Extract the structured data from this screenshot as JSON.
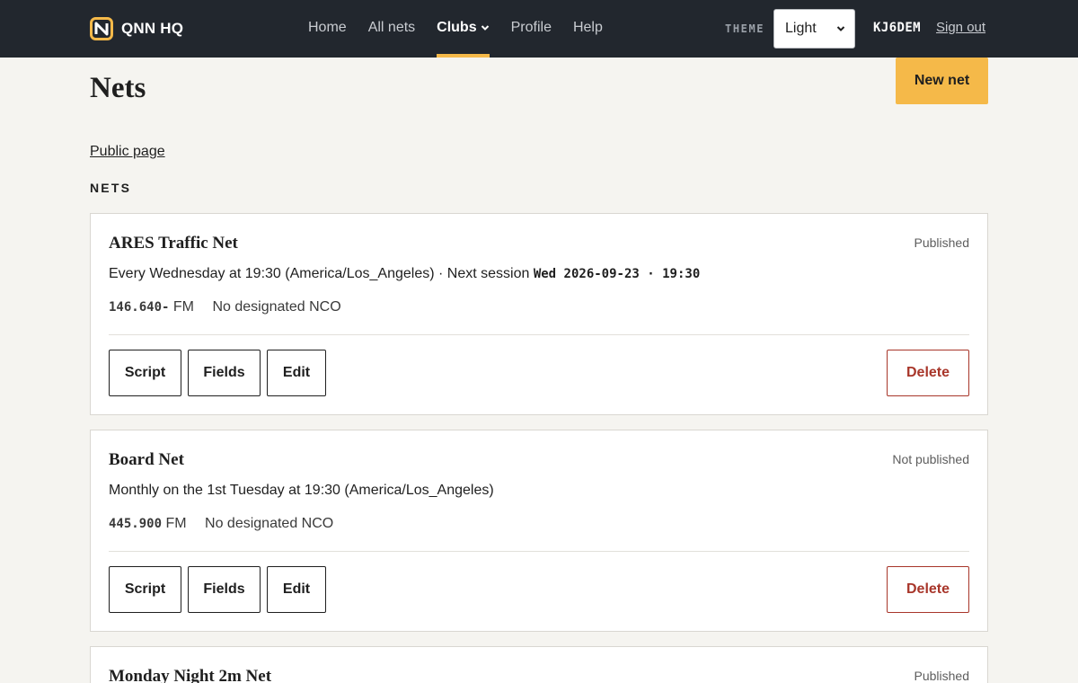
{
  "app": {
    "brand_name": "QNN HQ",
    "accent_color": "#f5b949",
    "nav_bg_color": "#22272e",
    "danger_color": "#a8362a"
  },
  "nav": {
    "items": [
      {
        "label": "Home",
        "active": false
      },
      {
        "label": "All nets",
        "active": false
      },
      {
        "label": "Clubs",
        "active": true,
        "has_dropdown": true
      },
      {
        "label": "Profile",
        "active": false
      },
      {
        "label": "Help",
        "active": false
      }
    ]
  },
  "header": {
    "theme_label": "THEME",
    "theme_value": "Light",
    "callsign": "KJ6DEM",
    "signout_label": "Sign out"
  },
  "page": {
    "title": "Nets",
    "new_net_label": "New net",
    "public_link_label": "Public page",
    "section_label": "NETS"
  },
  "cards": [
    {
      "title": "ARES Traffic Net",
      "status": "Published",
      "schedule": "Every Wednesday at 19:30 (America/Los_Angeles) · Next session",
      "next_session": "Wed 2026-09-23 · 19:30",
      "frequency": "146.640-",
      "mode": "FM",
      "nco": "No designated NCO",
      "buttons": {
        "script": "Script",
        "fields": "Fields",
        "edit": "Edit",
        "delete": "Delete"
      }
    },
    {
      "title": "Board Net",
      "status": "Not published",
      "schedule": "Monthly on the 1st Tuesday at 19:30 (America/Los_Angeles)",
      "frequency": "445.900",
      "mode": "FM",
      "nco": "No designated NCO",
      "buttons": {
        "script": "Script",
        "fields": "Fields",
        "edit": "Edit",
        "delete": "Delete"
      }
    },
    {
      "title": "Monday Night 2m Net",
      "status": "Published"
    }
  ]
}
